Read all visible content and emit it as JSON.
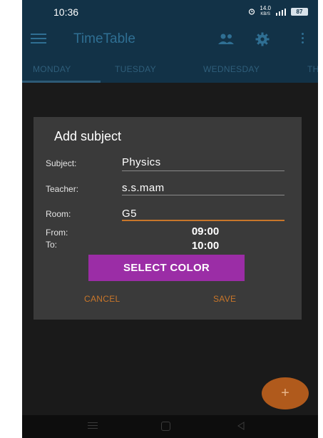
{
  "status_bar": {
    "time": "10:36",
    "net_speed_value": "14.0",
    "net_speed_unit": "KB/S",
    "battery": "87"
  },
  "app_bar": {
    "title": "TimeTable",
    "icons": [
      "menu-icon",
      "people-icon",
      "gear-icon",
      "more-icon"
    ]
  },
  "tabs": [
    {
      "label": "MONDAY",
      "selected": true
    },
    {
      "label": "TUESDAY",
      "selected": false
    },
    {
      "label": "WEDNESDAY",
      "selected": false
    },
    {
      "label": "TH",
      "selected": false
    }
  ],
  "dialog": {
    "title": "Add subject",
    "subject": {
      "label": "Subject:",
      "value": "Physics"
    },
    "teacher": {
      "label": "Teacher:",
      "value": "s.s.mam"
    },
    "room": {
      "label": "Room:",
      "value": "G5"
    },
    "from": {
      "label": "From:",
      "value": "09:00"
    },
    "to": {
      "label": "To:",
      "value": "10:00"
    },
    "select_color_label": "SELECT COLOR",
    "cancel_label": "CANCEL",
    "save_label": "SAVE"
  },
  "fab": {
    "label": "+"
  },
  "colors": {
    "primary_dark": "#123247",
    "accent": "#c8762a",
    "select_color_button": "#9b2da6",
    "dialog_background": "#3a3a3a"
  }
}
